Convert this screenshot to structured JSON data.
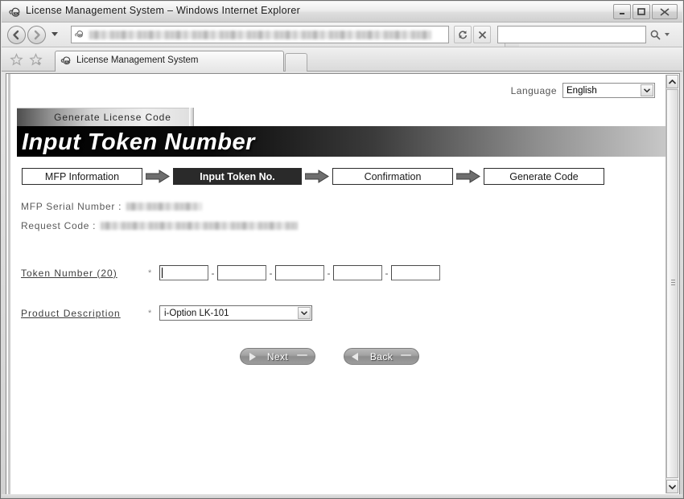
{
  "browser": {
    "title": "License Management System – Windows Internet Explorer",
    "title_icon": "ie-logo-icon",
    "window_controls": {
      "minimize": "–",
      "maximize": "□",
      "close": "✕"
    },
    "nav": {
      "back_icon": "back-arrow-icon",
      "forward_icon": "forward-arrow-icon",
      "history_dropdown_icon": "chevron-down-icon"
    },
    "address_bar": {
      "value": "",
      "icon": "page-icon",
      "dropdown_icon": "chevron-down-icon",
      "redacted": true
    },
    "refresh_icon": "refresh-icon",
    "stop_icon": "stop-x-icon",
    "search": {
      "value": "",
      "placeholder": "",
      "go_icon": "magnifier-icon",
      "dropdown_icon": "chevron-down-icon"
    },
    "favorites": {
      "favorites_icon": "star-icon",
      "add_favorite_icon": "star-plus-icon"
    },
    "tab": {
      "label": "License Management System",
      "icon": "ie-logo-icon"
    },
    "new_tab_label": ""
  },
  "page": {
    "language": {
      "label": "Language",
      "selected": "English",
      "arrow_icon": "chevron-down-icon"
    },
    "app_tab": {
      "label": "Generate License Code"
    },
    "title": "Input Token Number",
    "steps": [
      {
        "label": "MFP Information",
        "active": false
      },
      {
        "label": "Input Token No.",
        "active": true
      },
      {
        "label": "Confirmation",
        "active": false
      },
      {
        "label": "Generate Code",
        "active": false
      }
    ],
    "step_arrow_icon": "right-arrow-icon",
    "info": [
      {
        "label": "MFP Serial Number :",
        "value": "",
        "redacted": true
      },
      {
        "label": "Request Code :",
        "value": "",
        "redacted": true
      }
    ],
    "fields": {
      "token": {
        "label": "Token Number (20)",
        "required_marker": "*",
        "separator": "-",
        "segments": [
          "",
          "",
          "",
          "",
          ""
        ],
        "focused_index": 0
      },
      "product": {
        "label": "Product Description",
        "required_marker": "*",
        "selected": "i-Option LK-101",
        "arrow_icon": "chevron-down-icon"
      }
    },
    "buttons": {
      "next": {
        "label": "Next",
        "icon": "triangle-right-icon"
      },
      "back": {
        "label": "Back",
        "icon": "triangle-left-icon"
      }
    },
    "scrollbar": {
      "up_icon": "chevron-up-icon",
      "down_icon": "chevron-down-icon",
      "grip_icon": "grip-lines-icon"
    }
  },
  "colors": {
    "title_band_start": "#000000",
    "title_band_end": "#c8c8c8",
    "active_step_bg": "#2a2a2a",
    "button_bg": "#9d9d9d",
    "label_text": "#3d3d3d",
    "info_text": "#5a5a5a"
  }
}
